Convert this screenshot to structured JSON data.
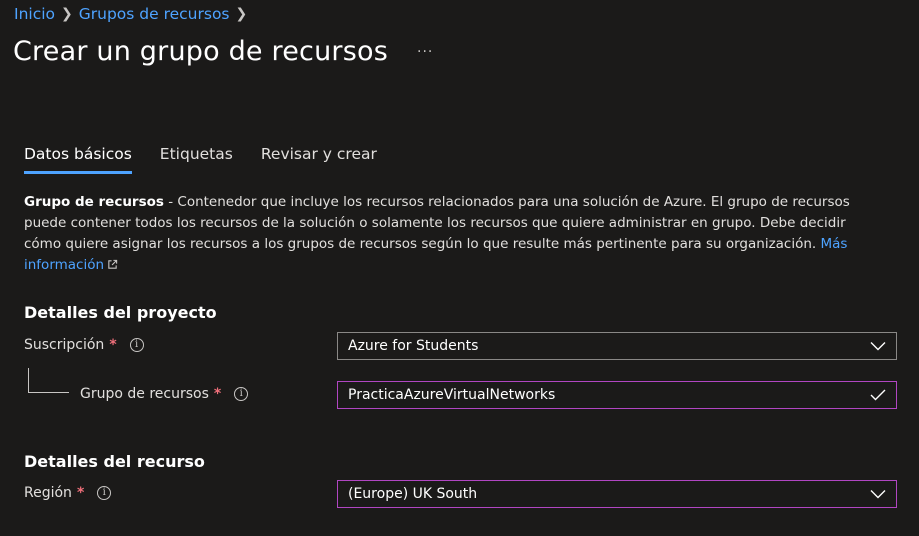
{
  "breadcrumb": {
    "items": [
      "Inicio",
      "Grupos de recursos"
    ]
  },
  "page": {
    "title": "Crear un grupo de recursos",
    "more": "···"
  },
  "tabs": [
    {
      "label": "Datos básicos",
      "active": true
    },
    {
      "label": "Etiquetas",
      "active": false
    },
    {
      "label": "Revisar y crear",
      "active": false
    }
  ],
  "description": {
    "bold": "Grupo de recursos",
    "text": " - Contenedor que incluye los recursos relacionados para una solución de Azure. El grupo de recursos puede contener todos los recursos de la solución o solamente los recursos que quiere administrar en grupo. Debe decidir cómo quiere asignar los recursos a los grupos de recursos según lo que resulte más pertinente para su organización.",
    "link": "Más información"
  },
  "project": {
    "heading": "Detalles del proyecto",
    "subscription": {
      "label": "Suscripción",
      "value": "Azure for Students"
    },
    "resource_group": {
      "label": "Grupo de recursos",
      "value": "PracticaAzureVirtualNetworks"
    }
  },
  "resource": {
    "heading": "Detalles del recurso",
    "region": {
      "label": "Región",
      "value": "(Europe) UK South"
    }
  },
  "colors": {
    "accent": "#4ea3ff",
    "required": "#f1707b",
    "focus": "#b146c2",
    "background": "#1b1a19"
  }
}
